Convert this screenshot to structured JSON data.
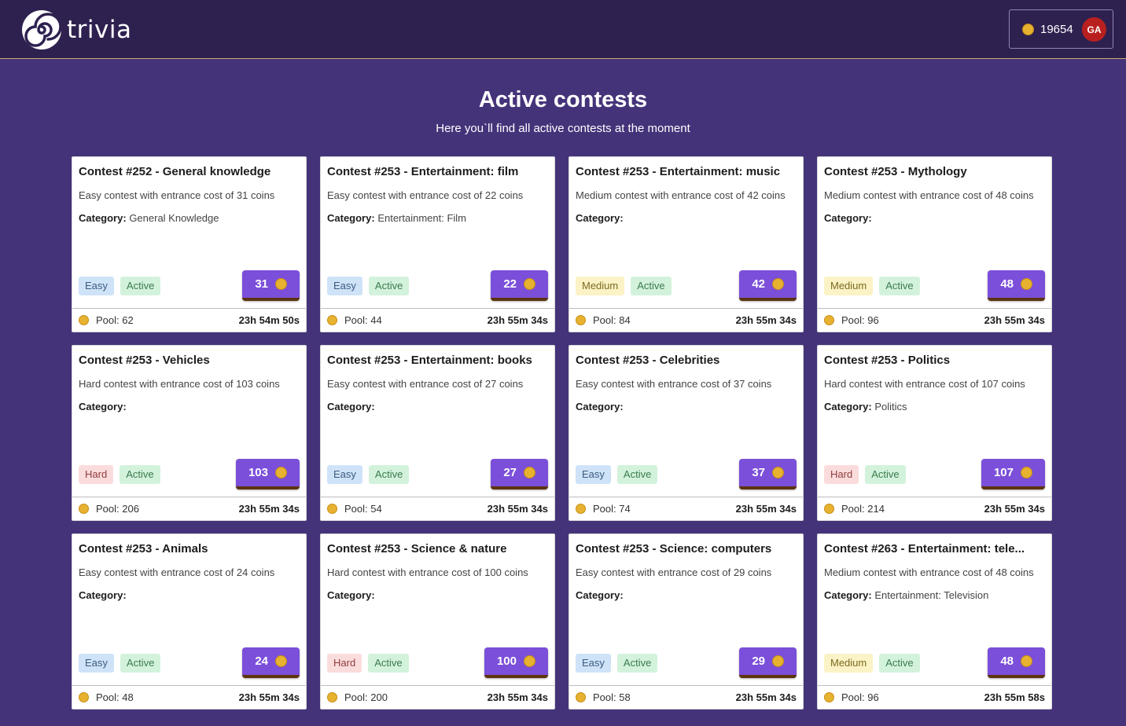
{
  "header": {
    "logo_text": "trivia",
    "balance": "19654",
    "avatar_initials": "GA"
  },
  "main": {
    "title": "Active contests",
    "subtitle": "Here you`ll find all active contests at the moment"
  },
  "labels": {
    "category": "Category:",
    "pool_prefix": "Pool: "
  },
  "contests": [
    {
      "title": "Contest #252 - General knowledge",
      "description": "Easy contest with entrance cost of 31 coins",
      "category": "General Knowledge",
      "difficulty": "Easy",
      "status": "Active",
      "cost": "31",
      "pool": "62",
      "timer": "23h 54m 50s"
    },
    {
      "title": "Contest #253 - Entertainment: film",
      "description": "Easy contest with entrance cost of 22 coins",
      "category": "Entertainment: Film",
      "difficulty": "Easy",
      "status": "Active",
      "cost": "22",
      "pool": "44",
      "timer": "23h 55m 34s"
    },
    {
      "title": "Contest #253 - Entertainment: music",
      "description": "Medium contest with entrance cost of 42 coins",
      "category": "",
      "difficulty": "Medium",
      "status": "Active",
      "cost": "42",
      "pool": "84",
      "timer": "23h 55m 34s"
    },
    {
      "title": "Contest #253 - Mythology",
      "description": "Medium contest with entrance cost of 48 coins",
      "category": "",
      "difficulty": "Medium",
      "status": "Active",
      "cost": "48",
      "pool": "96",
      "timer": "23h 55m 34s"
    },
    {
      "title": "Contest #253 - Vehicles",
      "description": "Hard contest with entrance cost of 103 coins",
      "category": "",
      "difficulty": "Hard",
      "status": "Active",
      "cost": "103",
      "pool": "206",
      "timer": "23h 55m 34s"
    },
    {
      "title": "Contest #253 - Entertainment: books",
      "description": "Easy contest with entrance cost of 27 coins",
      "category": "",
      "difficulty": "Easy",
      "status": "Active",
      "cost": "27",
      "pool": "54",
      "timer": "23h 55m 34s"
    },
    {
      "title": "Contest #253 - Celebrities",
      "description": "Easy contest with entrance cost of 37 coins",
      "category": "",
      "difficulty": "Easy",
      "status": "Active",
      "cost": "37",
      "pool": "74",
      "timer": "23h 55m 34s"
    },
    {
      "title": "Contest #253 - Politics",
      "description": "Hard contest with entrance cost of 107 coins",
      "category": "Politics",
      "difficulty": "Hard",
      "status": "Active",
      "cost": "107",
      "pool": "214",
      "timer": "23h 55m 34s"
    },
    {
      "title": "Contest #253 - Animals",
      "description": "Easy contest with entrance cost of 24 coins",
      "category": "",
      "difficulty": "Easy",
      "status": "Active",
      "cost": "24",
      "pool": "48",
      "timer": "23h 55m 34s"
    },
    {
      "title": "Contest #253 - Science & nature",
      "description": "Hard contest with entrance cost of 100 coins",
      "category": "",
      "difficulty": "Hard",
      "status": "Active",
      "cost": "100",
      "pool": "200",
      "timer": "23h 55m 34s"
    },
    {
      "title": "Contest #253 - Science: computers",
      "description": "Easy contest with entrance cost of 29 coins",
      "category": "",
      "difficulty": "Easy",
      "status": "Active",
      "cost": "29",
      "pool": "58",
      "timer": "23h 55m 34s"
    },
    {
      "title": "Contest #263 - Entertainment: tele...",
      "description": "Medium contest with entrance cost of 48 coins",
      "category": "Entertainment: Television",
      "difficulty": "Medium",
      "status": "Active",
      "cost": "48",
      "pool": "96",
      "timer": "23h 55m 58s"
    }
  ]
}
